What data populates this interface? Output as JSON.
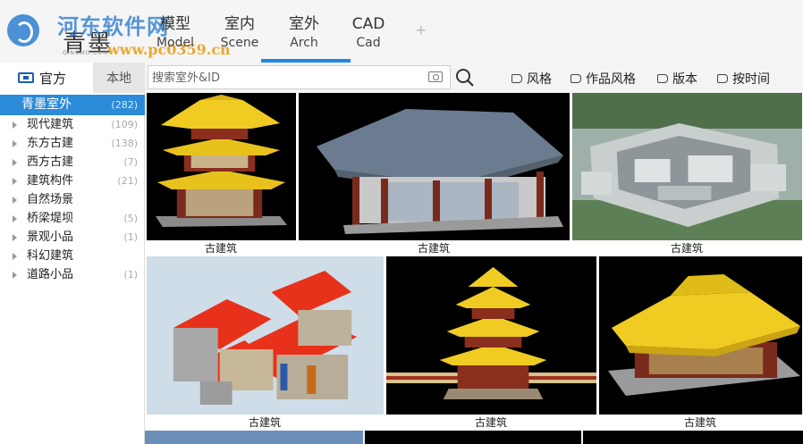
{
  "header": {
    "brand": "青墨",
    "brand_sub": "QINGMO.COM",
    "watermark": "河东软件网",
    "watermark_url": "www.pc0359.cn",
    "tabs": [
      {
        "zh": "模型",
        "en": "Model"
      },
      {
        "zh": "室内",
        "en": "Scene"
      },
      {
        "zh": "室外",
        "en": "Arch"
      },
      {
        "zh": "CAD",
        "en": "Cad"
      }
    ],
    "active_tab": "室外",
    "add_label": "+"
  },
  "toolbar": {
    "source_official": "官方",
    "source_local": "本地",
    "search_placeholder": "搜索室外&ID",
    "filters": [
      "风格",
      "作品风格",
      "版本",
      "按时间"
    ]
  },
  "sidebar": {
    "root": {
      "label": "青墨室外",
      "count": "(282)"
    },
    "items": [
      {
        "label": "现代建筑",
        "count": "(109)"
      },
      {
        "label": "东方古建",
        "count": "(138)"
      },
      {
        "label": "西方古建",
        "count": "(7)"
      },
      {
        "label": "建筑构件",
        "count": "(21)"
      },
      {
        "label": "自然场景",
        "count": ""
      },
      {
        "label": "桥梁堤坝",
        "count": "(5)"
      },
      {
        "label": "景观小品",
        "count": "(1)"
      },
      {
        "label": "科幻建筑",
        "count": ""
      },
      {
        "label": "道路小品",
        "count": "(1)"
      }
    ]
  },
  "grid": {
    "captions": [
      "古建筑",
      "古建筑",
      "古建筑",
      "古建筑",
      "古建筑",
      "古建筑"
    ]
  },
  "colors": {
    "accent": "#1e88e5",
    "sidebar_active": "#2b8bd9",
    "roof_yellow": "#e8c21c",
    "roof_red": "#e8311a"
  }
}
